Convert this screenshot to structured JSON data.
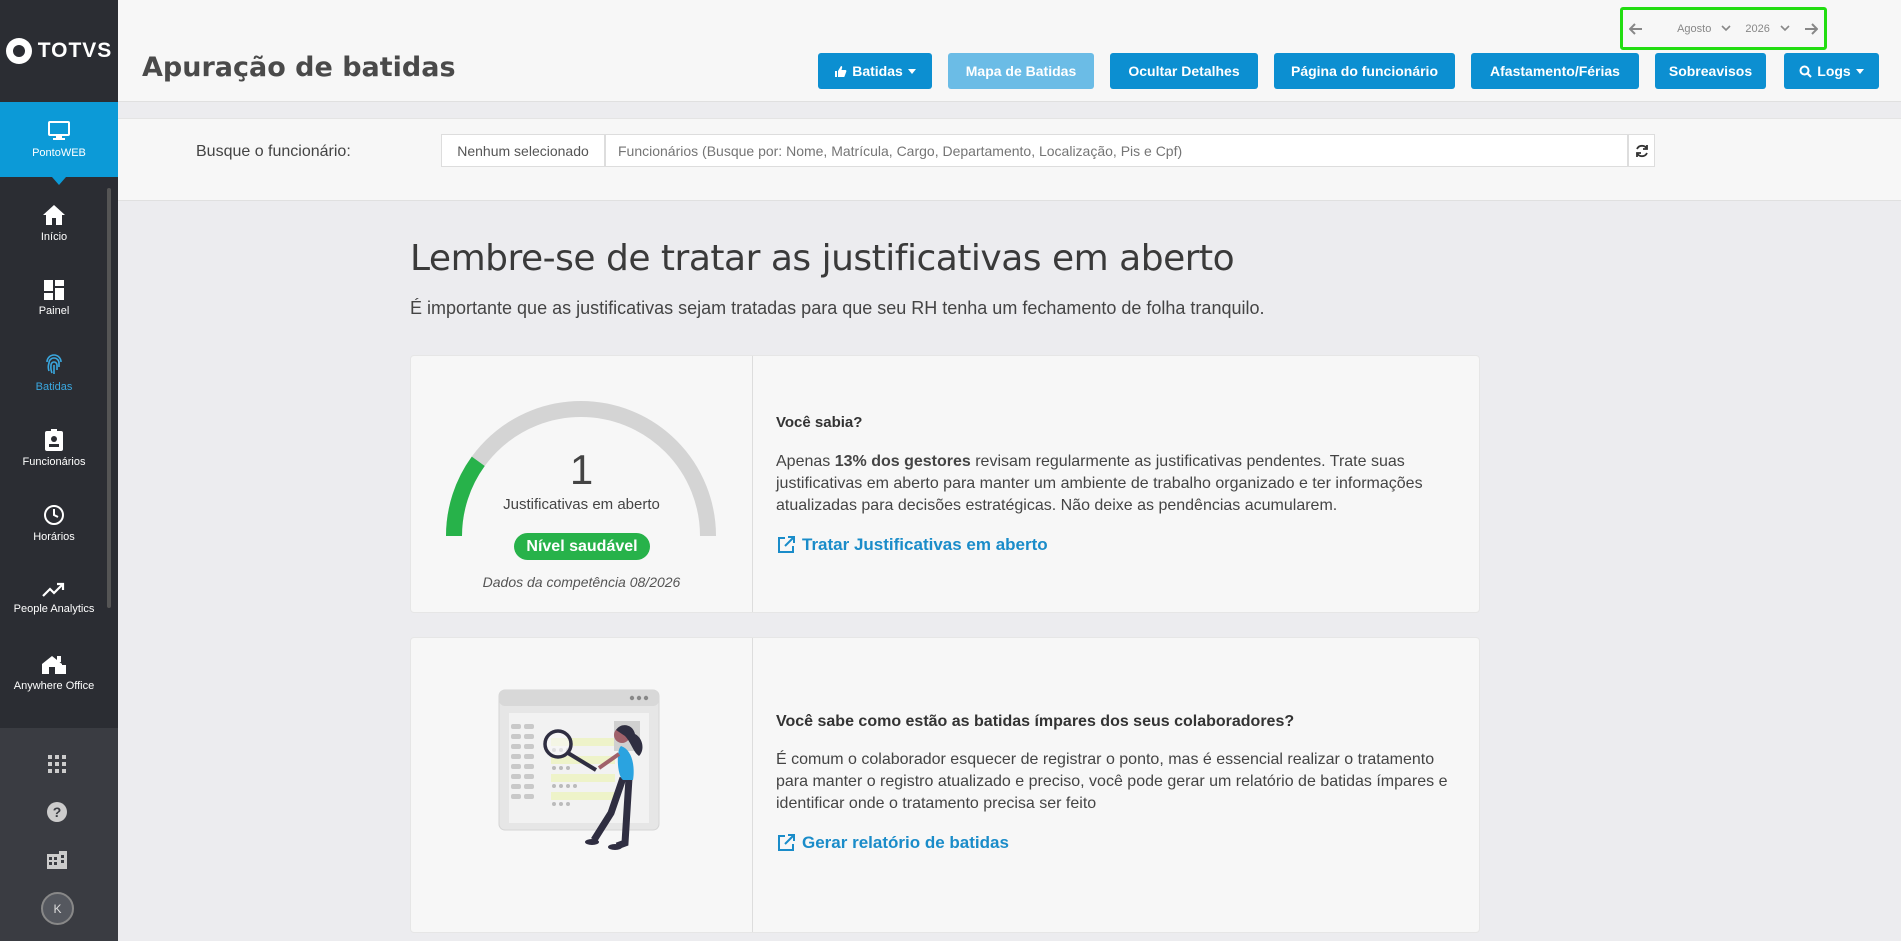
{
  "app": {
    "logo_text": "TOTVS"
  },
  "sidebar": {
    "active": {
      "label": "PontoWEB",
      "icon": "monitor-icon"
    },
    "items": [
      {
        "label": "Início",
        "icon": "home-icon"
      },
      {
        "label": "Painel",
        "icon": "dashboard-icon"
      },
      {
        "label": "Batidas",
        "icon": "fingerprint-icon"
      },
      {
        "label": "Funcionários",
        "icon": "badge-icon"
      },
      {
        "label": "Horários",
        "icon": "clock-icon"
      },
      {
        "label": "People Analytics",
        "icon": "trending-icon"
      },
      {
        "label": "Anywhere Office",
        "icon": "home-office-icon"
      }
    ],
    "bottom": {
      "avatar_initial": "K"
    }
  },
  "header": {
    "title": "Apuração de batidas",
    "period": {
      "month": "Agosto",
      "year": "2026"
    },
    "buttons": {
      "batidas": "Batidas",
      "mapa": "Mapa de Batidas",
      "ocultar": "Ocultar Detalhes",
      "funcionario": "Página do funcionário",
      "afastamento": "Afastamento/Férias",
      "sobreavisos": "Sobreavisos",
      "logs": "Logs"
    }
  },
  "search": {
    "label": "Busque o funcionário:",
    "selected": "Nenhum selecionado",
    "placeholder": "Funcionários (Busque por: Nome, Matrícula, Cargo, Departamento, Localização, Pis e Cpf)"
  },
  "main": {
    "headline": "Lembre-se de tratar as justificativas em aberto",
    "subline": "É importante que as justificativas sejam tratadas para que seu RH tenha um fechamento de folha tranquilo.",
    "card1": {
      "gauge_value": "1",
      "gauge_label": "Justificativas em aberto",
      "gauge_fraction": 0.2,
      "health": "Nível saudável",
      "competence": "Dados da competência 08/2026",
      "heading": "Você sabia?",
      "text_prefix": "Apenas ",
      "text_bold": "13% dos gestores",
      "text_suffix": " revisam regularmente as justificativas pendentes. Trate suas justificativas em aberto para manter um ambiente de trabalho organizado e ter informações atualizadas para decisões estratégicas. Não deixe as pendências acumularem.",
      "link": "Tratar Justificativas em aberto"
    },
    "card2": {
      "heading": "Você sabe como estão as batidas ímpares dos seus colaboradores?",
      "text": "É comum o colaborador esquecer de registrar o ponto, mas é essencial realizar o tratamento para manter o registro atualizado e preciso, você pode gerar um relatório de batidas ímpares e identificar onde o tratamento precisa ser feito",
      "link": "Gerar relatório de batidas"
    }
  },
  "colors": {
    "accent": "#0c8fd1",
    "sidebar": "#2b2d33",
    "healthy": "#27b24a",
    "highlight": "#22dd11"
  }
}
